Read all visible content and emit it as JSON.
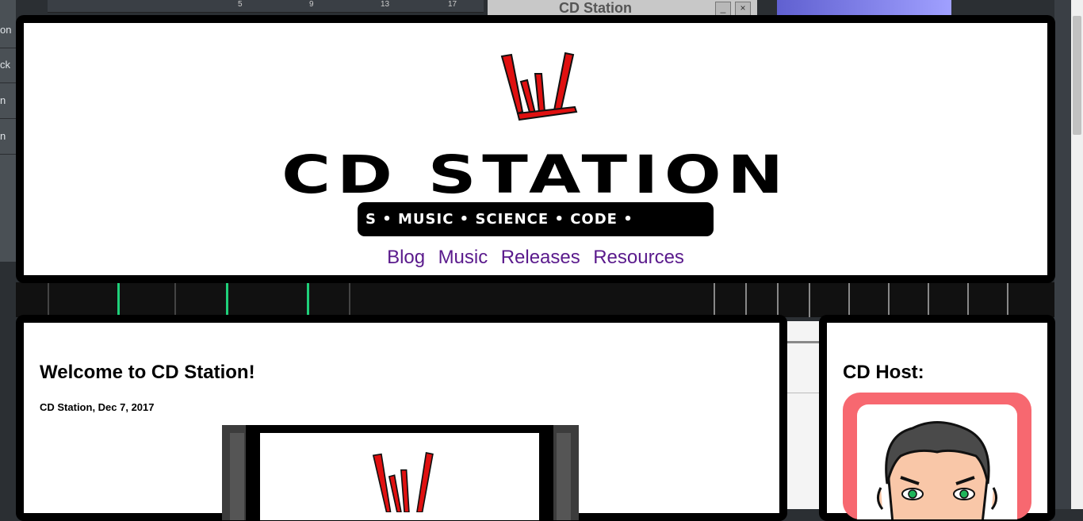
{
  "background": {
    "window_title": "CD Station",
    "left_panel_items": [
      "on",
      "ck",
      "n",
      "n"
    ],
    "ruler_marks": [
      "5",
      "9",
      "13",
      "17"
    ],
    "window_buttons": [
      "_",
      "×"
    ]
  },
  "header": {
    "site_title": "CD STATION",
    "ticker_text": "S • MUSIC • SCIENCE • CODE •",
    "nav": [
      {
        "label": "Blog"
      },
      {
        "label": "Music"
      },
      {
        "label": "Releases"
      },
      {
        "label": "Resources"
      }
    ]
  },
  "post": {
    "title": "Welcome to CD Station!",
    "meta": "CD Station, Dec 7, 2017"
  },
  "sidebar": {
    "title": "CD Host:"
  },
  "colors": {
    "logo_red": "#e01010",
    "nav_link": "#5a1a8c",
    "avatar_frame": "#f76870",
    "panel_border": "#000000"
  }
}
